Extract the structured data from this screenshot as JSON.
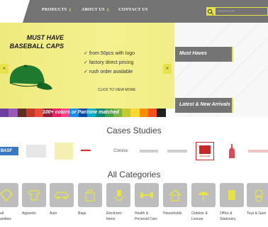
{
  "nav": {
    "products": "PRODUCTS",
    "about": "ABOUT US",
    "contact": "CONTACT US",
    "search_placeholder": "SEARCH OR..."
  },
  "banner": {
    "title_line1": "MUST HAVE",
    "title_line2": "BASEBALL CAPS",
    "bullets": [
      "from 50pcs with logo",
      "factory direct pricing",
      "rush order available"
    ],
    "cta": "CLICK TO VIEW MORE",
    "colorbar_text": "100+ colors or Pantone matched"
  },
  "side_tags": [
    "Must Haves",
    "Latest & New Arrivals"
  ],
  "case_studies": {
    "heading": "Cases Studies",
    "logos": [
      "BASF",
      "",
      "",
      "",
      "Corona",
      "",
      "",
      "DELHAIZE",
      "",
      ""
    ]
  },
  "categories": {
    "heading": "All Categories",
    "items": [
      {
        "label": "all\nantities",
        "icon": "tag-icon"
      },
      {
        "label": "Apparels",
        "icon": "tshirt-icon"
      },
      {
        "label": "Auto",
        "icon": "car-icon"
      },
      {
        "label": "Bags",
        "icon": "bag-icon"
      },
      {
        "label": "Electronic\nItems",
        "icon": "hand-icon"
      },
      {
        "label": "Health &\nPersonal Care",
        "icon": "dumbbell-icon"
      },
      {
        "label": "Households",
        "icon": "house-icon"
      },
      {
        "label": "Outdoor &\nLeisure",
        "icon": "umbrella-icon"
      },
      {
        "label": "Office &\nStationery",
        "icon": "notebook-icon"
      },
      {
        "label": "Toys & Gam",
        "icon": "bear-icon"
      }
    ]
  },
  "colors": {
    "accent": "#e8e24a",
    "nav_bg": "#737373",
    "tile_bg": "#bdbdbd"
  }
}
